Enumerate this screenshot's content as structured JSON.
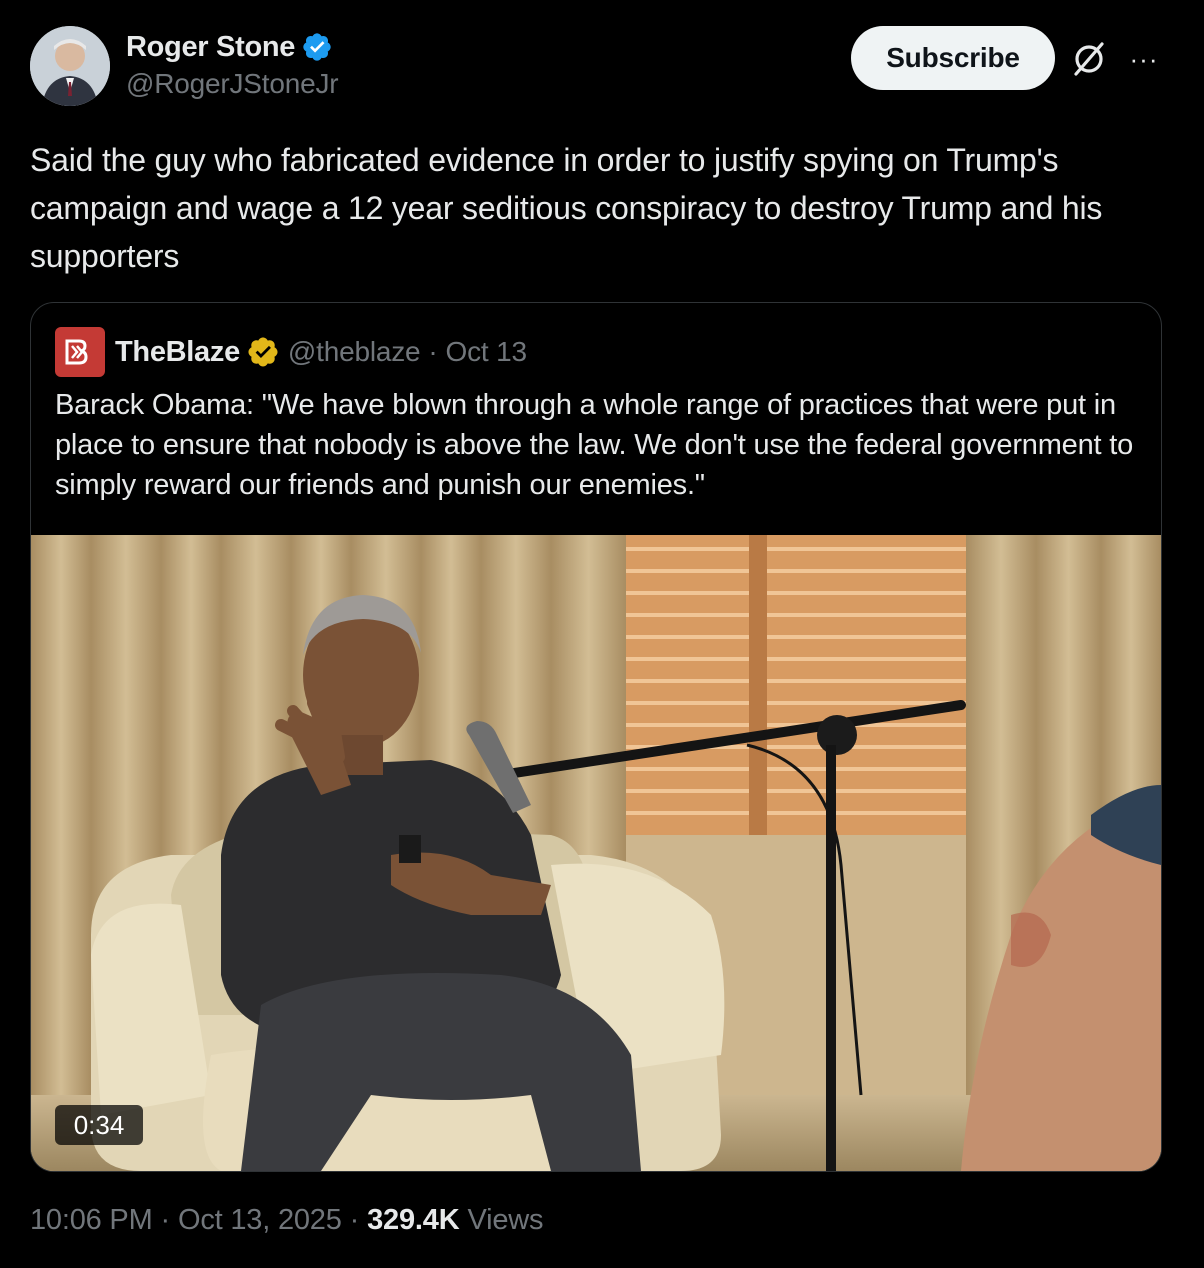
{
  "author": {
    "display_name": "Roger Stone",
    "handle": "@RogerJStoneJr",
    "verified_color": "#1d9bf0"
  },
  "actions": {
    "subscribe_label": "Subscribe",
    "grok_icon": "grok-icon",
    "more_icon": "more-icon",
    "more_glyph": "···"
  },
  "tweet": {
    "text": "Said the guy who fabricated evidence in order to justify spying on Trump's campaign and wage a 12 year seditious conspiracy to destroy Trump and his supporters"
  },
  "quote": {
    "display_name": "TheBlaze",
    "handle": "@theblaze",
    "separator": "·",
    "date": "Oct 13",
    "badge_color": "#e2b719",
    "logo_color": "#c43a35",
    "text": "Barack Obama: \"We have blown through a whole range of practices that were put in place to ensure that nobody is above the law. We don't use the federal government to simply reward our friends and punish our enemies.\"",
    "video": {
      "duration": "0:34"
    }
  },
  "footer": {
    "time": "10:06 PM",
    "date": "Oct 13, 2025",
    "separator": "·",
    "views_count": "329.4K",
    "views_label": "Views"
  }
}
